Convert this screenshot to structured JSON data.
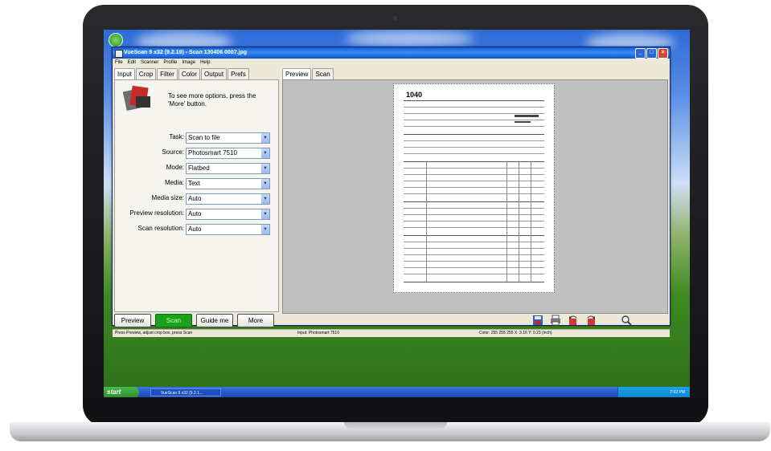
{
  "window": {
    "title": "VueScan 9 x32 (9.2.19) - Scan 130406 0007.jpg",
    "menu": [
      "File",
      "Edit",
      "Scanner",
      "Profile",
      "Image",
      "Help"
    ]
  },
  "left_tabs": [
    "Input",
    "Crop",
    "Filter",
    "Color",
    "Output",
    "Prefs"
  ],
  "options_hint": "To see more options, press the 'More' button.",
  "fields": [
    {
      "label": "Task:",
      "value": "Scan to file"
    },
    {
      "label": "Source:",
      "value": "Photosmart 7510"
    },
    {
      "label": "Mode:",
      "value": "Flatbed"
    },
    {
      "label": "Media:",
      "value": "Text"
    },
    {
      "label": "Media size:",
      "value": "Auto"
    },
    {
      "label": "Preview resolution:",
      "value": "Auto"
    },
    {
      "label": "Scan resolution:",
      "value": "Auto"
    }
  ],
  "buttons": {
    "preview": "Preview",
    "scan": "Scan",
    "guide": "Guide me",
    "more": "More"
  },
  "right_tabs": [
    "Preview",
    "Scan"
  ],
  "document": {
    "form_number": "1040"
  },
  "status": {
    "left": "Press Preview, adjust crop box, press Scan",
    "middle": "Input: Photosmart 7510",
    "right": "Color: 255 255 255  X: 3.16  Y: 0.23 (inch)"
  },
  "taskbar": {
    "start": "start",
    "task": "VueScan 9 x32 (9.2.1...",
    "clock": "7:02 PM"
  },
  "icons": [
    "save-icon",
    "print-icon",
    "rotate-left-icon",
    "rotate-right-icon",
    "zoom-icon"
  ],
  "colors": {
    "accent": "#1aa31a",
    "titlebar": "#0a5fde",
    "taskbar": "#2456c9"
  }
}
